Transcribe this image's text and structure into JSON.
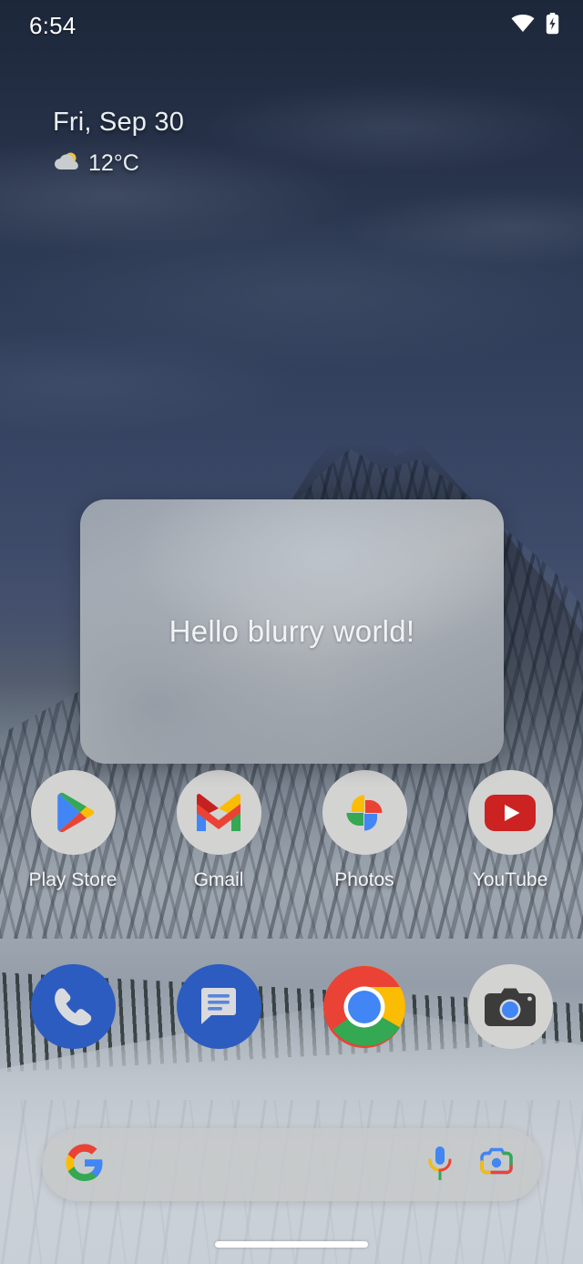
{
  "status_bar": {
    "clock": "6:54",
    "icons": [
      {
        "name": "wifi-icon",
        "label": "Wi-Fi"
      },
      {
        "name": "battery-charging-icon",
        "label": "Battery charging"
      }
    ]
  },
  "widget": {
    "date": "Fri, Sep 30",
    "temperature": "12°C",
    "weather_icon": "partly-cloudy-icon"
  },
  "blur_panel": {
    "text": "Hello blurry world!"
  },
  "app_grid": [
    {
      "label": "Play Store",
      "icon": "play-store-icon"
    },
    {
      "label": "Gmail",
      "icon": "gmail-icon"
    },
    {
      "label": "Photos",
      "icon": "google-photos-icon"
    },
    {
      "label": "YouTube",
      "icon": "youtube-icon"
    }
  ],
  "dock": [
    {
      "label": "Phone",
      "icon": "phone-icon"
    },
    {
      "label": "Messages",
      "icon": "messages-icon"
    },
    {
      "label": "Chrome",
      "icon": "chrome-icon"
    },
    {
      "label": "Camera",
      "icon": "camera-icon"
    }
  ],
  "search_bar": {
    "value": "",
    "placeholder": "",
    "logo_icon": "google-g-icon",
    "actions": [
      {
        "name": "voice-search-icon",
        "label": "Voice search"
      },
      {
        "name": "google-lens-icon",
        "label": "Google Lens"
      }
    ]
  },
  "navigation": {
    "home_indicator": "home-gesture-bar"
  },
  "colors": {
    "google_blue": "#4285F4",
    "google_red": "#EA4335",
    "google_yellow": "#FBBC04",
    "google_green": "#34A853",
    "youtube_red": "#CC2222",
    "dock_blue": "#2C5CC0",
    "icon_bg": "#D3D3D2",
    "search_bg": "#C6C8C9",
    "panel_gray": "#A5ABB3"
  }
}
